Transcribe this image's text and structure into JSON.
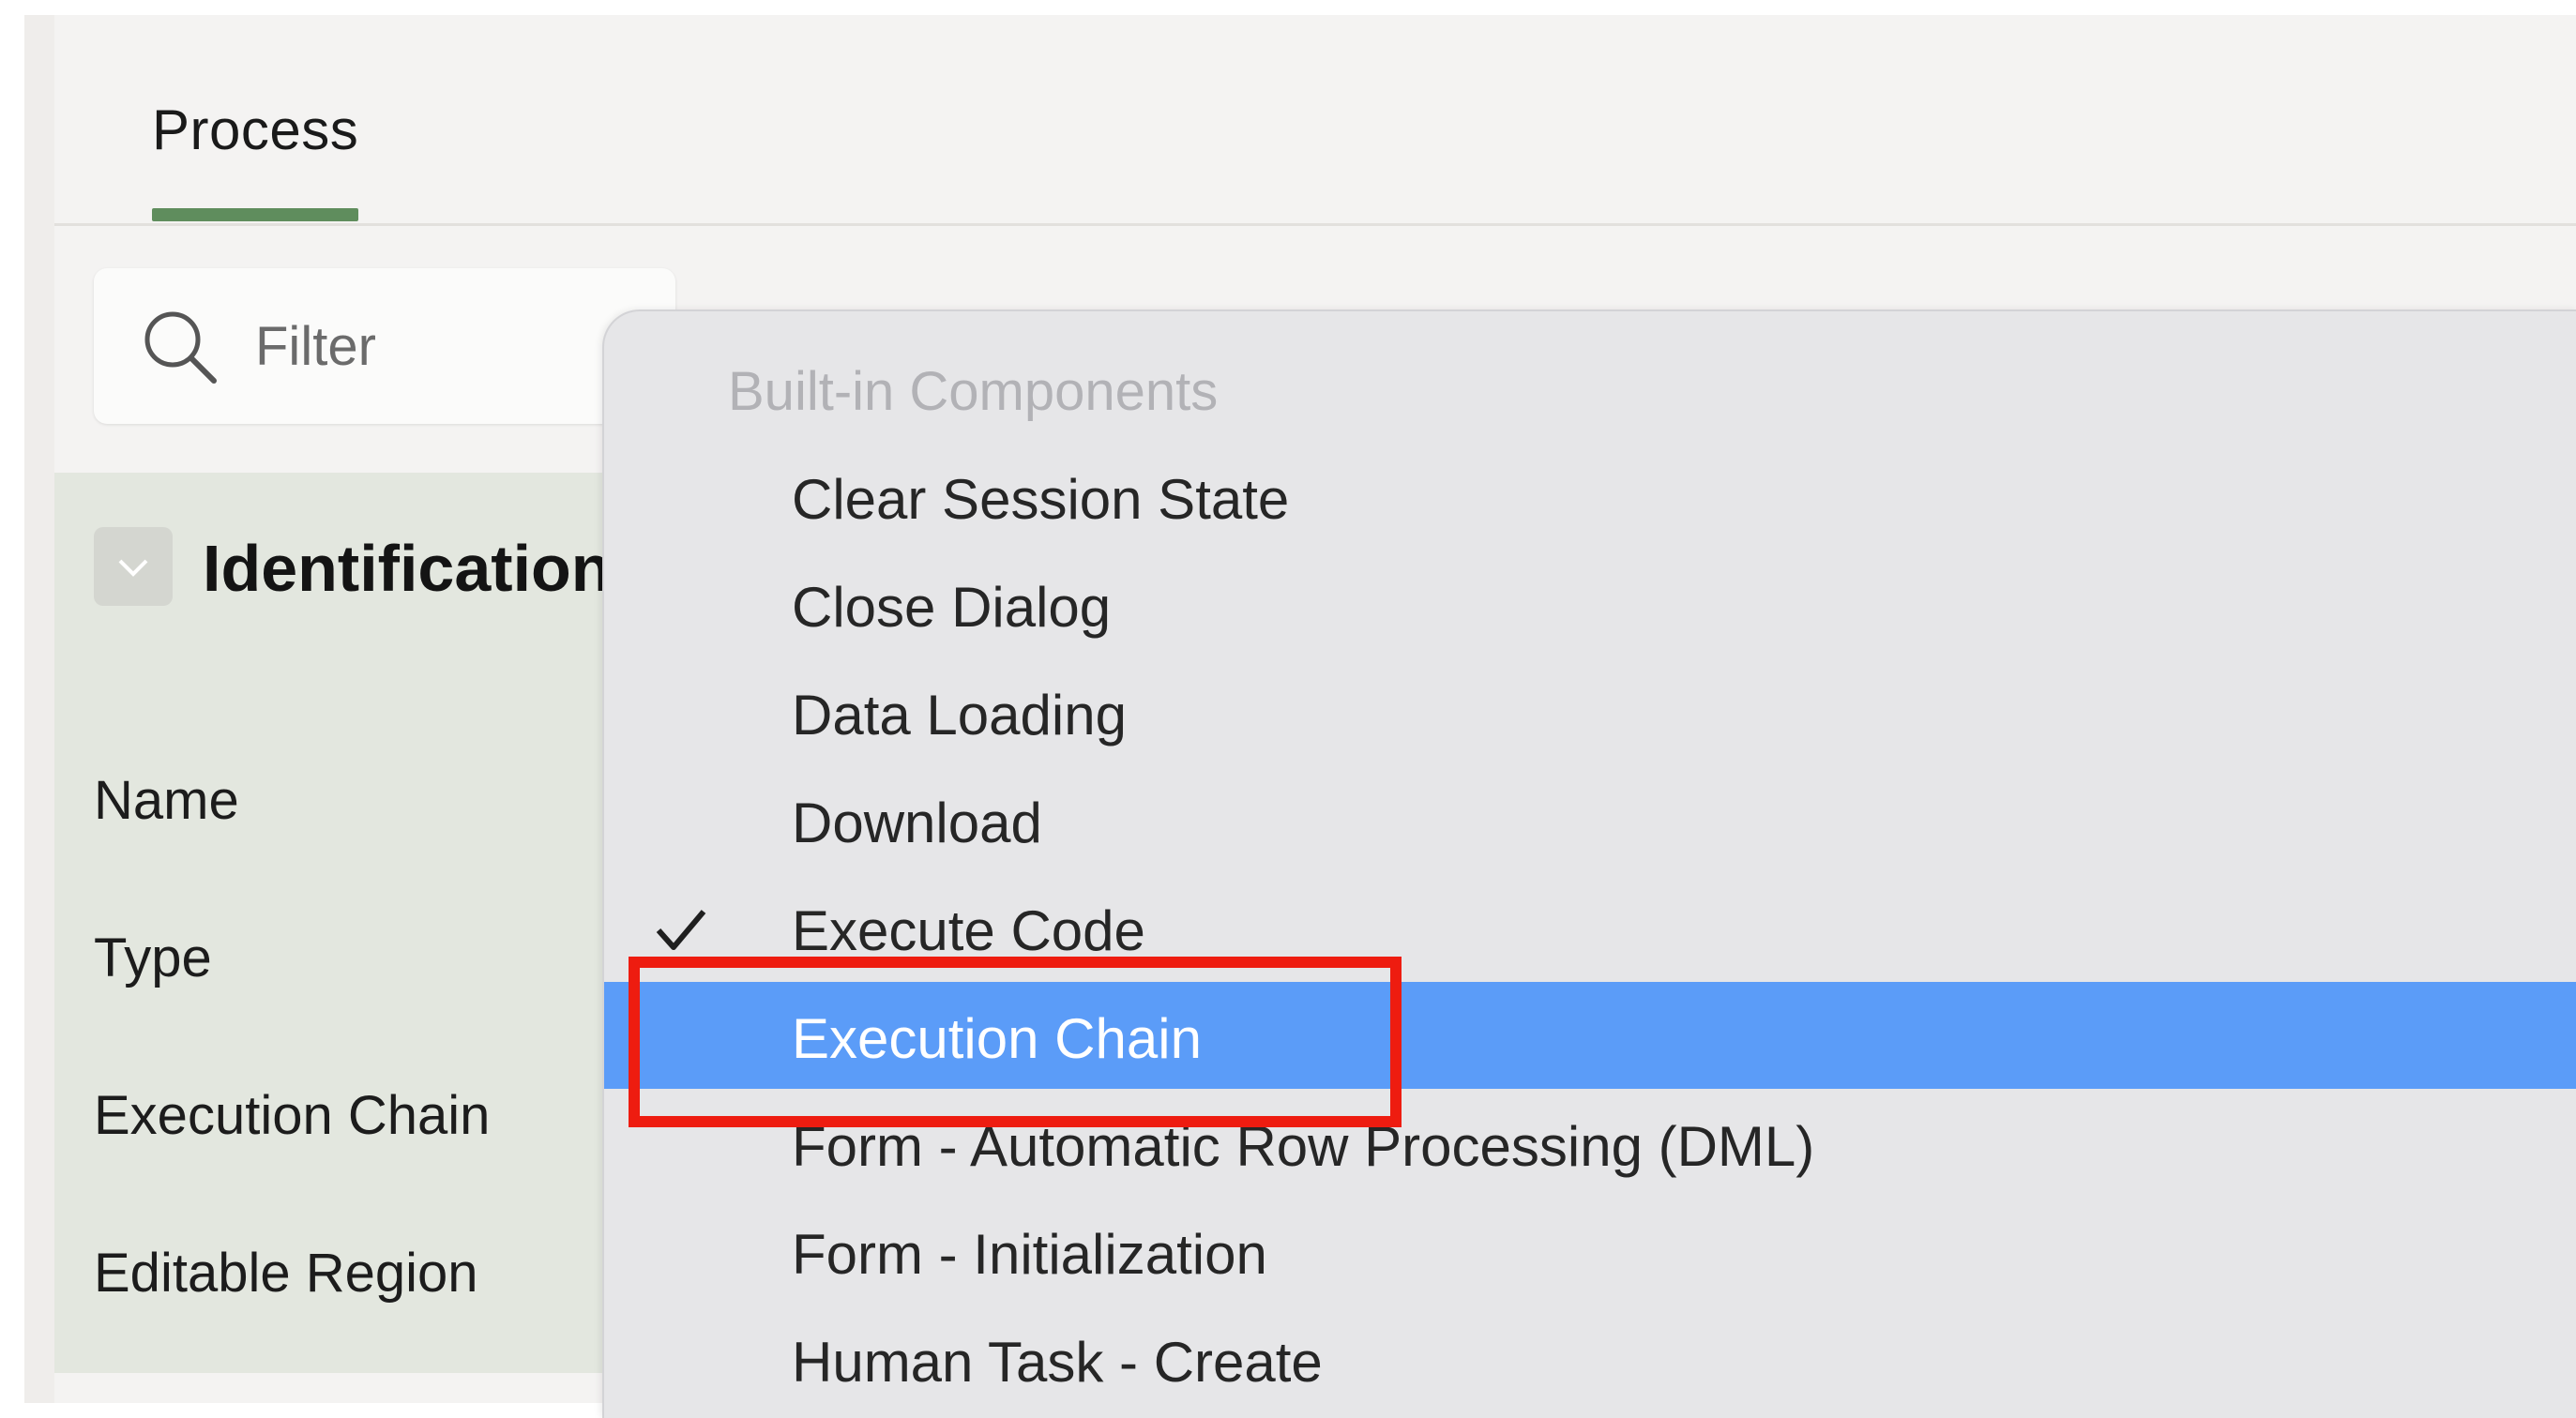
{
  "tabs": [
    {
      "label": "Process",
      "active": true
    }
  ],
  "filter": {
    "placeholder": "Filter",
    "icon": "search-icon"
  },
  "identification": {
    "title": "Identification",
    "fields": [
      {
        "label": "Name"
      },
      {
        "label": "Type"
      },
      {
        "label": "Execution Chain"
      },
      {
        "label": "Editable Region"
      }
    ]
  },
  "menu": {
    "group_label": "Built-in Components",
    "items": [
      {
        "label": "Clear Session State",
        "checked": false,
        "selected": false
      },
      {
        "label": "Close Dialog",
        "checked": false,
        "selected": false
      },
      {
        "label": "Data Loading",
        "checked": false,
        "selected": false
      },
      {
        "label": "Download",
        "checked": false,
        "selected": false
      },
      {
        "label": "Execute Code",
        "checked": true,
        "selected": false
      },
      {
        "label": "Execution Chain",
        "checked": false,
        "selected": true
      },
      {
        "label": "Form - Automatic Row Processing (DML)",
        "checked": false,
        "selected": false
      },
      {
        "label": "Form - Initialization",
        "checked": false,
        "selected": false
      },
      {
        "label": "Human Task - Create",
        "checked": false,
        "selected": false
      }
    ]
  },
  "colors": {
    "tab_underline": "#5f8d5d",
    "selected_item": "#5b9cf8",
    "highlight_box": "#ee1c10",
    "section_background": "#e3e7df"
  }
}
